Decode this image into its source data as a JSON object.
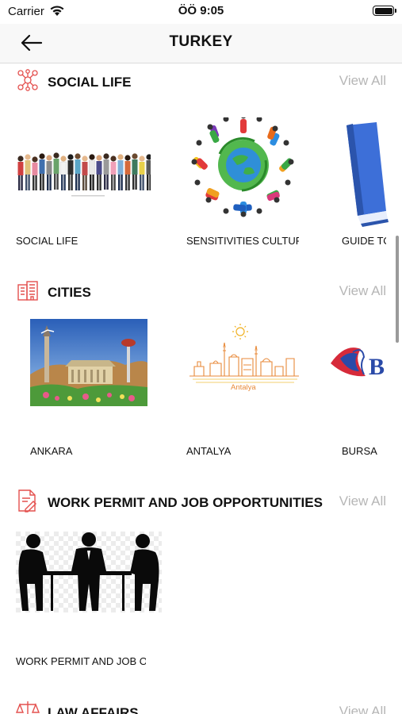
{
  "status_bar": {
    "carrier": "Carrier",
    "time": "ÖÖ 9:05"
  },
  "nav": {
    "title": "TURKEY",
    "back_icon": "arrow-left-icon"
  },
  "colors": {
    "accent": "#e4504e",
    "view_all": "#b6b6b6",
    "nav_bg": "#f8f8f8"
  },
  "sections": [
    {
      "title": "SOCIAL LIFE",
      "icon": "network-people-icon",
      "view_all": "View All",
      "items": [
        {
          "label": "SOCIAL LIFE",
          "image": "crowd-of-people"
        },
        {
          "label": "SENSITIVITIES   CULTURE",
          "image": "globe-with-people"
        },
        {
          "label": "GUIDE TO",
          "image": "blue-book"
        }
      ]
    },
    {
      "title": "CITIES",
      "icon": "buildings-icon",
      "view_all": "View All",
      "items": [
        {
          "label": "ANKARA",
          "image": "ankara-landmarks"
        },
        {
          "label": "ANTALYA",
          "image": "antalya-skyline",
          "image_text": "Antalya"
        },
        {
          "label": "BURSA",
          "image": "bursa-logo",
          "image_text": "B"
        }
      ]
    },
    {
      "title": "WORK PERMIT AND JOB OPPORTUNITIES",
      "icon": "document-edit-icon",
      "view_all": "View All",
      "items": [
        {
          "label": "WORK PERMIT AND JOB OPPORTUNITIES",
          "image": "meeting-silhouettes"
        }
      ]
    },
    {
      "title": "LAW AFFAIRS",
      "icon": "scales-icon",
      "view_all": "View All",
      "items": []
    }
  ]
}
